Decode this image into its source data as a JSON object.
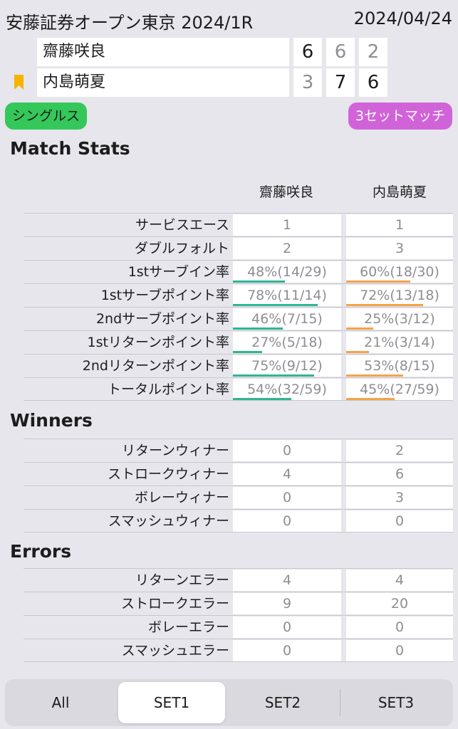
{
  "header": {
    "tournament": "安藤証券オープン東京 2024/1R",
    "date": "2024/04/24"
  },
  "players": [
    {
      "name": "齋藤咲良",
      "sets": [
        "6",
        "6",
        "2"
      ],
      "serving": false
    },
    {
      "name": "内島萌夏",
      "sets": [
        "3",
        "7",
        "6"
      ],
      "serving": true
    }
  ],
  "badges": {
    "type": "シングルス",
    "format": "3セットマッチ"
  },
  "colors": {
    "p1_bar": "#2fb593",
    "p2_bar": "#f5a347",
    "type_badge": "#34c759",
    "format_badge": "#d163d9"
  },
  "sections": {
    "match_stats": {
      "title": "Match Stats",
      "col_p1": "齋藤咲良",
      "col_p2": "内島萌夏",
      "rows": [
        {
          "label": "サービスエース",
          "p1": "1",
          "p2": "1"
        },
        {
          "label": "ダブルフォルト",
          "p1": "2",
          "p2": "3"
        },
        {
          "label": "1stサーブイン率",
          "p1": "48%(14/29)",
          "p2": "60%(18/30)",
          "p1_pct": 48,
          "p2_pct": 60
        },
        {
          "label": "1stサーブポイント率",
          "p1": "78%(11/14)",
          "p2": "72%(13/18)",
          "p1_pct": 78,
          "p2_pct": 72
        },
        {
          "label": "2ndサーブポイント率",
          "p1": "46%(7/15)",
          "p2": "25%(3/12)",
          "p1_pct": 46,
          "p2_pct": 25
        },
        {
          "label": "1stリターンポイント率",
          "p1": "27%(5/18)",
          "p2": "21%(3/14)",
          "p1_pct": 27,
          "p2_pct": 21
        },
        {
          "label": "2ndリターンポイント率",
          "p1": "75%(9/12)",
          "p2": "53%(8/15)",
          "p1_pct": 75,
          "p2_pct": 53
        },
        {
          "label": "トータルポイント率",
          "p1": "54%(32/59)",
          "p2": "45%(27/59)",
          "p1_pct": 54,
          "p2_pct": 45
        }
      ]
    },
    "winners": {
      "title": "Winners",
      "rows": [
        {
          "label": "リターンウィナー",
          "p1": "0",
          "p2": "2"
        },
        {
          "label": "ストロークウィナー",
          "p1": "4",
          "p2": "6"
        },
        {
          "label": "ボレーウィナー",
          "p1": "0",
          "p2": "3"
        },
        {
          "label": "スマッシュウィナー",
          "p1": "0",
          "p2": "0"
        }
      ]
    },
    "errors": {
      "title": "Errors",
      "rows": [
        {
          "label": "リターンエラー",
          "p1": "4",
          "p2": "4"
        },
        {
          "label": "ストロークエラー",
          "p1": "9",
          "p2": "20"
        },
        {
          "label": "ボレーエラー",
          "p1": "0",
          "p2": "0"
        },
        {
          "label": "スマッシュエラー",
          "p1": "0",
          "p2": "0"
        }
      ]
    }
  },
  "tabs": [
    {
      "label": "All",
      "active": false
    },
    {
      "label": "SET1",
      "active": true
    },
    {
      "label": "SET2",
      "active": false
    },
    {
      "label": "SET3",
      "active": false
    }
  ]
}
